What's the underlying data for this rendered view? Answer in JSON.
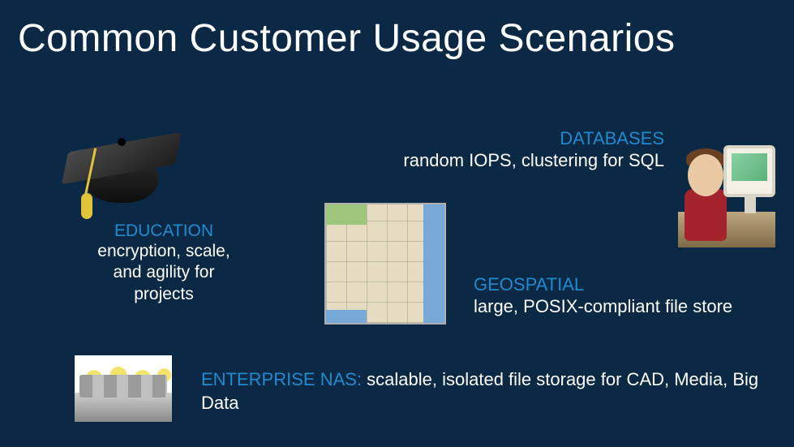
{
  "title": "Common Customer Usage Scenarios",
  "education": {
    "heading": "EDUCATION",
    "body": "encryption, scale, and agility for projects",
    "icon": "graduation-cap"
  },
  "databases": {
    "heading": "DATABASES",
    "body": "random IOPS, clustering for SQL",
    "icon": "child-with-computer"
  },
  "geospatial": {
    "heading": "GEOSPATIAL",
    "body": "large, POSIX-compliant file store",
    "icon": "regional-map"
  },
  "enterprise": {
    "heading": "ENTERPRISE NAS:",
    "body": " scalable, isolated file storage for CAD, Media, Big Data",
    "icon": "engine-pistons"
  },
  "colors": {
    "background": "#0b2944",
    "accent": "#1f8ad0",
    "text": "#ffffff"
  }
}
